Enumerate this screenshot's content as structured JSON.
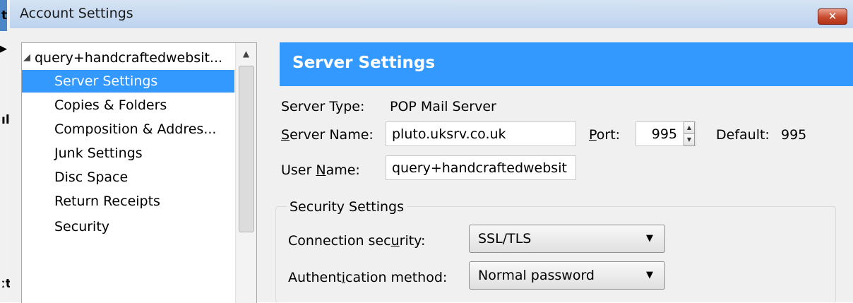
{
  "background": {
    "glyphs": [
      "t",
      "▶",
      "ıl",
      "ːt"
    ]
  },
  "window": {
    "title": "Account Settings",
    "close_label": "✕"
  },
  "tree": {
    "root": "query+handcraftedwebsit...",
    "items": [
      "Server Settings",
      "Copies & Folders",
      "Composition & Addres...",
      "Junk Settings",
      "Disc Space",
      "Return Receipts",
      "Security"
    ],
    "selected_index": 0
  },
  "server_settings": {
    "header": "Server Settings",
    "server_type_label": "Server Type:",
    "server_type_value": "POP Mail Server",
    "server_name_label": "Server Name:",
    "server_name_value": "pluto.uksrv.co.uk",
    "port_label": "Port:",
    "port_value": "995",
    "default_label": "Default:",
    "default_value": "995",
    "user_name_label": "User Name:",
    "user_name_value": "query+handcraftedwebsit"
  },
  "security": {
    "legend": "Security Settings",
    "connection_label": "Connection security:",
    "connection_value": "SSL/TLS",
    "auth_label": "Authentication method:",
    "auth_value": "Normal password"
  },
  "colors": {
    "selection": "#3399ff",
    "header": "#3399ff",
    "close": "#c74a2f"
  }
}
